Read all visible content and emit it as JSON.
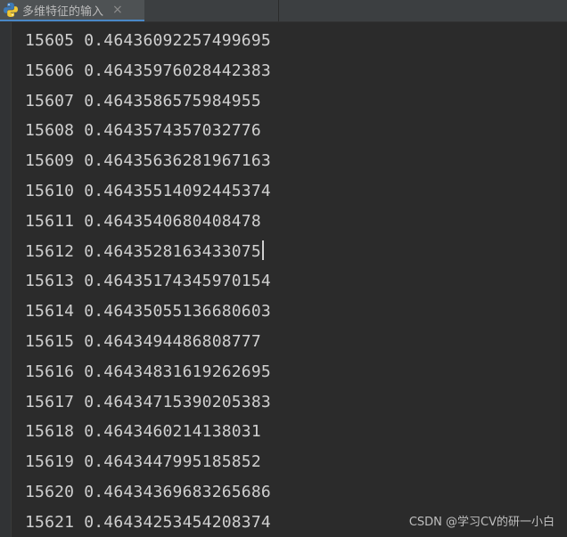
{
  "tab": {
    "title": "多维特征的输入",
    "close_glyph": "×",
    "icon": "python-file-icon"
  },
  "console": {
    "lines": [
      "15605 0.46436092257499695",
      "15606 0.46435976028442383",
      "15607 0.4643586575984955",
      "15608 0.4643574357032776",
      "15609 0.46435636281967163",
      "15610 0.46435514092445374",
      "15611 0.4643540680408478",
      "15612 0.4643528163433075",
      "15613 0.46435174345970154",
      "15614 0.46435055136680603",
      "15615 0.4643494486808777",
      "15616 0.46434831619262695",
      "15617 0.46434715390205383",
      "15618 0.4643460214138031",
      "15619 0.4643447995185852",
      "15620 0.46434369683265686",
      "15621 0.46434253454208374"
    ],
    "caret_line_index": 7
  },
  "watermark": "CSDN @学习CV的研一小白",
  "colors": {
    "background": "#2b2b2b",
    "text": "#cfcfcf",
    "tab_active": "#4e5254",
    "tab_underline": "#4a88c7"
  }
}
